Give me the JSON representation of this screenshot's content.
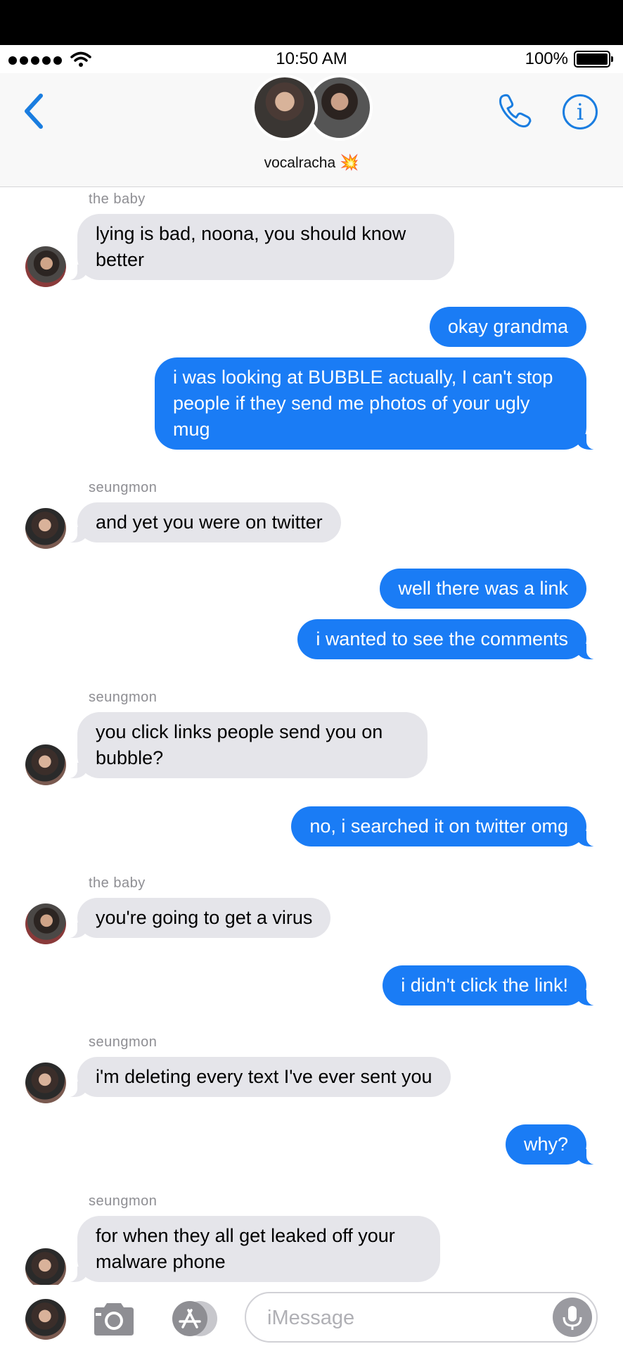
{
  "status_bar": {
    "time": "10:50 AM",
    "battery_percent": "100%",
    "signal_bars": 5
  },
  "nav": {
    "title": "vocalracha",
    "title_emoji": "💥",
    "icons": [
      "back-chevron-icon",
      "phone-icon",
      "info-icon"
    ],
    "accent_color": "#1a7de0"
  },
  "thread": {
    "messages": [
      {
        "from": "in",
        "sender": "the baby",
        "text": "lying is bad, noona, you should know better"
      },
      {
        "from": "out",
        "text": "okay grandma"
      },
      {
        "from": "out",
        "text": "i was looking at BUBBLE actually, I can't stop people if they send me photos of your ugly mug"
      },
      {
        "from": "in",
        "sender": "seungmon",
        "text": "and yet you were on twitter"
      },
      {
        "from": "out",
        "text": "well there was a link"
      },
      {
        "from": "out",
        "text": "i wanted to see the comments"
      },
      {
        "from": "in",
        "sender": "seungmon",
        "text": "you click links people send you on bubble?"
      },
      {
        "from": "out",
        "text": "no, i searched it on twitter omg"
      },
      {
        "from": "in",
        "sender": "the baby",
        "text": "you're going to get a virus"
      },
      {
        "from": "out",
        "text": "i didn't click the link!"
      },
      {
        "from": "in",
        "sender": "seungmon",
        "text": "i'm deleting every text I've ever sent you"
      },
      {
        "from": "out",
        "text": "why?"
      },
      {
        "from": "in",
        "sender": "seungmon",
        "text": "for when they all get leaked off your malware phone"
      }
    ],
    "incoming_bubble_color": "#e5e5ea",
    "outgoing_bubble_color": "#1a7cf5"
  },
  "input_bar": {
    "placeholder": "iMessage",
    "icons": [
      "camera-icon",
      "app-store-icon",
      "microphone-icon"
    ]
  }
}
